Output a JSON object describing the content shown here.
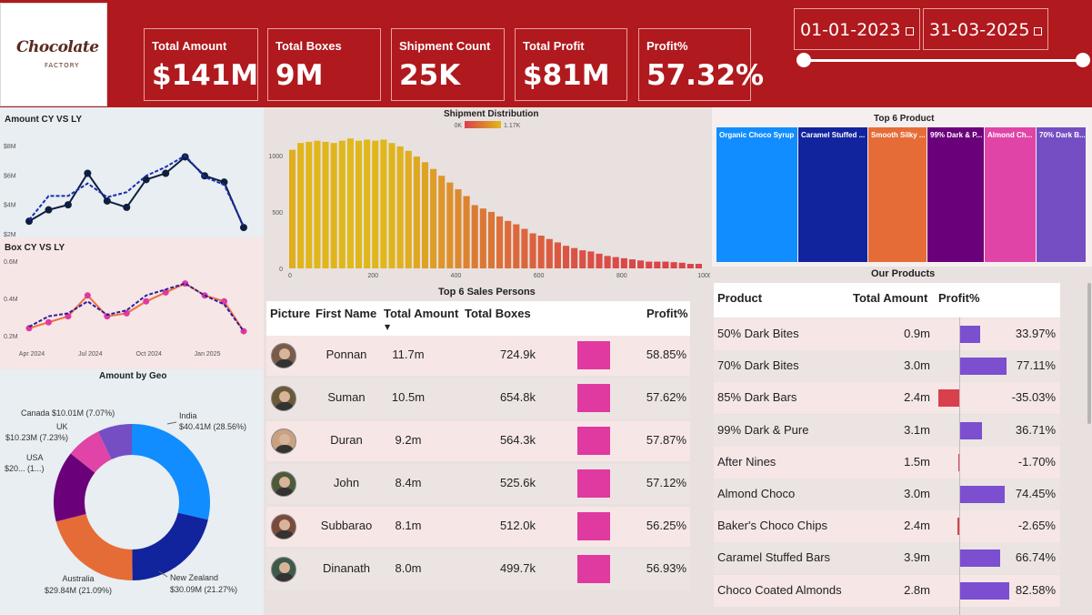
{
  "logo": {
    "text": "Chocolate",
    "sub": "FACTORY"
  },
  "kpis": [
    {
      "label": "Total Amount",
      "value": "$141M"
    },
    {
      "label": "Total Boxes",
      "value": "9M"
    },
    {
      "label": "Shipment Count",
      "value": "25K"
    },
    {
      "label": "Total Profit",
      "value": "$81M"
    },
    {
      "label": "Profit%",
      "value": "57.32%"
    }
  ],
  "dates": {
    "start": "01-01-2023",
    "end": "31-03-2025"
  },
  "date_slider": {
    "start_fraction": 0.0,
    "end_fraction": 1.0
  },
  "colors": {
    "header": "#b0191d",
    "accent_pink": "#e0399f",
    "accent_purple": "#7b4fcf",
    "negative": "#d9404c"
  },
  "chart_data": [
    {
      "type": "line",
      "title": "Amount CY VS LY",
      "yticks": [
        "$8M",
        "$6M",
        "$4M",
        "$2M"
      ],
      "ylim": [
        2,
        9
      ],
      "series": [
        {
          "name": "CY",
          "values": [
            3.0,
            3.9,
            4.3,
            6.8,
            4.6,
            4.1,
            6.3,
            6.8,
            8.1,
            6.6,
            6.1,
            2.5
          ]
        },
        {
          "name": "LY",
          "values": [
            3.1,
            5.0,
            5.0,
            6.0,
            4.9,
            5.3,
            6.6,
            7.3,
            8.2,
            6.5,
            5.9,
            2.6
          ]
        }
      ]
    },
    {
      "type": "line",
      "title": "Box CY VS LY",
      "yticks": [
        "0.6M",
        "0.4M",
        "0.2M"
      ],
      "ylim": [
        0.15,
        0.65
      ],
      "xticks": [
        "Apr 2024",
        "Jul 2024",
        "Oct 2024",
        "Jan 2025"
      ],
      "series": [
        {
          "name": "CY",
          "values": [
            0.2,
            0.24,
            0.28,
            0.42,
            0.28,
            0.3,
            0.38,
            0.44,
            0.5,
            0.42,
            0.38,
            0.18
          ]
        },
        {
          "name": "LY",
          "values": [
            0.21,
            0.28,
            0.3,
            0.38,
            0.29,
            0.32,
            0.42,
            0.46,
            0.5,
            0.42,
            0.36,
            0.18
          ]
        }
      ]
    },
    {
      "type": "bar",
      "title": "Shipment Distribution",
      "legend": {
        "min": "0K",
        "max": "1.17K"
      },
      "xticks": [
        0,
        200,
        400,
        600,
        800,
        1000
      ],
      "yticks": [
        0,
        500,
        1000
      ],
      "ylim": [
        0,
        1200
      ],
      "values": [
        1050,
        1110,
        1120,
        1130,
        1120,
        1110,
        1130,
        1150,
        1130,
        1140,
        1130,
        1140,
        1110,
        1080,
        1040,
        990,
        940,
        880,
        820,
        760,
        700,
        640,
        560,
        530,
        500,
        460,
        420,
        390,
        350,
        310,
        290,
        260,
        230,
        200,
        180,
        160,
        150,
        130,
        110,
        100,
        90,
        80,
        70,
        60,
        60,
        60,
        55,
        50,
        40,
        40
      ]
    },
    {
      "type": "pie",
      "title": "Amount by Geo",
      "slices": [
        {
          "name": "India",
          "label": "India",
          "value_text": "$40.41M (28.56%)",
          "value": 28.56,
          "color": "#118dff"
        },
        {
          "name": "New Zealand",
          "label": "New Zealand",
          "value_text": "$30.09M (21.27%)",
          "value": 21.27,
          "color": "#12239e"
        },
        {
          "name": "Australia",
          "label": "Australia",
          "value_text": "$29.84M (21.09%)",
          "value": 21.09,
          "color": "#e66c37"
        },
        {
          "name": "USA",
          "label": "USA",
          "value_text": "$20... (1...)",
          "value": 14.68,
          "color": "#6b007b"
        },
        {
          "name": "UK",
          "label": "UK",
          "value_text": "$10.23M (7.23%)",
          "value": 7.23,
          "color": "#e044a7"
        },
        {
          "name": "Canada",
          "label": "Canada $10.01M (7.07%)",
          "value_text": "",
          "value": 7.07,
          "color": "#744ec2"
        }
      ]
    },
    {
      "type": "treemap",
      "title": "Top 6 Product",
      "items": [
        {
          "name": "Organic Choco Syrup",
          "color": "#118dff"
        },
        {
          "name": "Caramel Stuffed ...",
          "color": "#12239e"
        },
        {
          "name": "Smooth Silky ...",
          "color": "#e66c37"
        },
        {
          "name": "99% Dark & P...",
          "color": "#6b007b"
        },
        {
          "name": "Almond Ch...",
          "color": "#e044a7"
        },
        {
          "name": "70% Dark B...",
          "color": "#744ec2"
        }
      ]
    }
  ],
  "sales_persons": {
    "title": "Top 6 Sales Persons",
    "headers": {
      "picture": "Picture",
      "first_name": "First Name",
      "amount": "Total Amount",
      "boxes": "Total Boxes",
      "profit": "Profit%"
    },
    "rows": [
      {
        "name": "Ponnan",
        "amount": "11.7m",
        "boxes": "724.9k",
        "profit": "58.85%"
      },
      {
        "name": "Suman",
        "amount": "10.5m",
        "boxes": "654.8k",
        "profit": "57.62%"
      },
      {
        "name": "Duran",
        "amount": "9.2m",
        "boxes": "564.3k",
        "profit": "57.87%"
      },
      {
        "name": "John",
        "amount": "8.4m",
        "boxes": "525.6k",
        "profit": "57.12%"
      },
      {
        "name": "Subbarao",
        "amount": "8.1m",
        "boxes": "512.0k",
        "profit": "56.25%"
      },
      {
        "name": "Dinanath",
        "amount": "8.0m",
        "boxes": "499.7k",
        "profit": "56.93%"
      }
    ]
  },
  "products": {
    "title": "Our Products",
    "headers": {
      "product": "Product",
      "amount": "Total Amount",
      "profit": "Profit%"
    },
    "rows": [
      {
        "product": "50% Dark Bites",
        "amount": "0.9m",
        "profit": "33.97%",
        "pct": 33.97
      },
      {
        "product": "70% Dark Bites",
        "amount": "3.0m",
        "profit": "77.11%",
        "pct": 77.11
      },
      {
        "product": "85% Dark Bars",
        "amount": "2.4m",
        "profit": "-35.03%",
        "pct": -35.03
      },
      {
        "product": "99% Dark & Pure",
        "amount": "3.1m",
        "profit": "36.71%",
        "pct": 36.71
      },
      {
        "product": "After Nines",
        "amount": "1.5m",
        "profit": "-1.70%",
        "pct": -1.7
      },
      {
        "product": "Almond Choco",
        "amount": "3.0m",
        "profit": "74.45%",
        "pct": 74.45
      },
      {
        "product": "Baker's Choco Chips",
        "amount": "2.4m",
        "profit": "-2.65%",
        "pct": -2.65
      },
      {
        "product": "Caramel Stuffed Bars",
        "amount": "3.9m",
        "profit": "66.74%",
        "pct": 66.74
      },
      {
        "product": "Choco Coated Almonds",
        "amount": "2.8m",
        "profit": "82.58%",
        "pct": 82.58
      }
    ]
  }
}
